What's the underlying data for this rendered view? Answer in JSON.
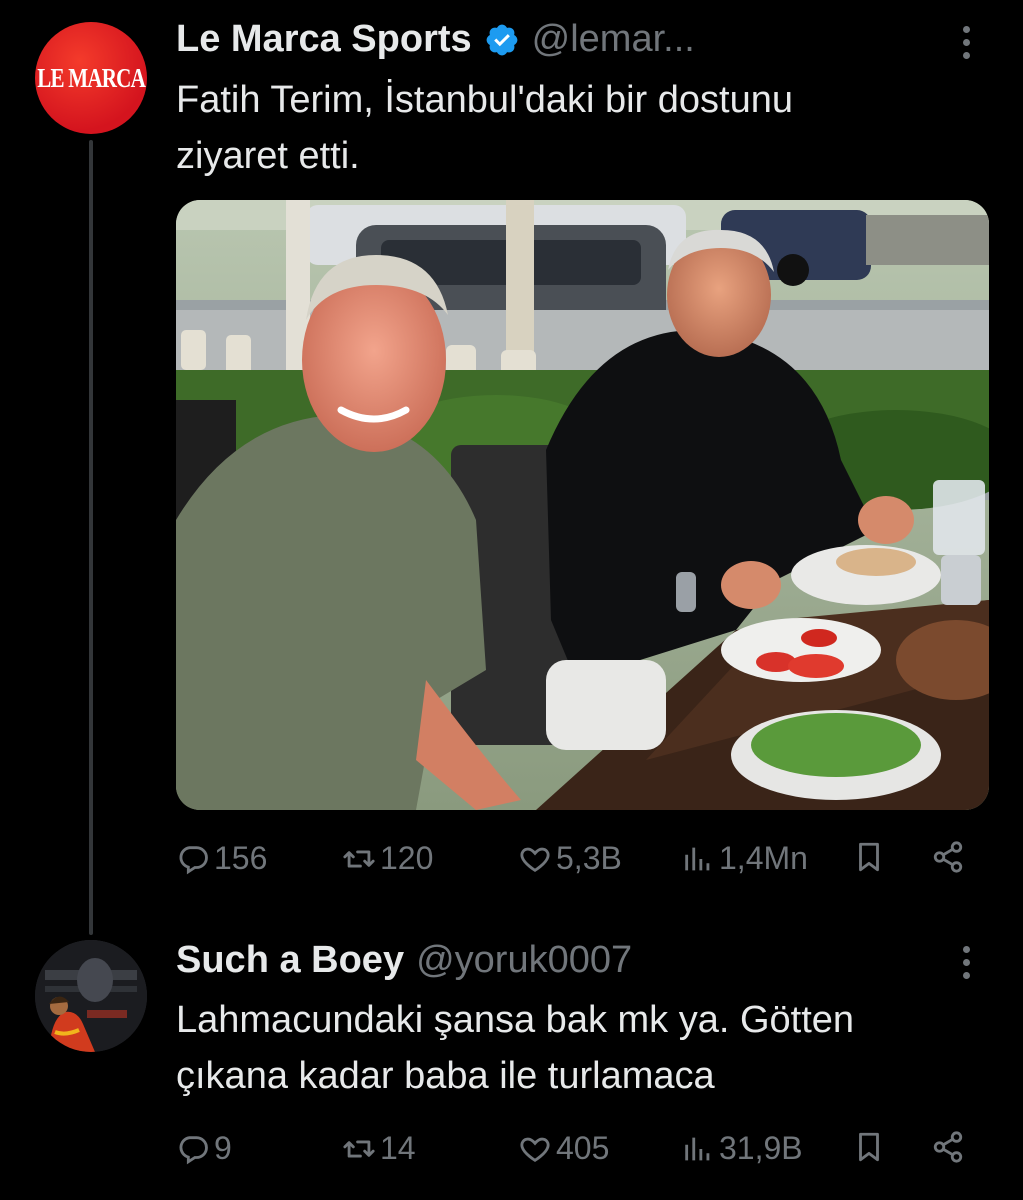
{
  "tweet": {
    "avatar_text": "LE MARCA",
    "author_name": "Le Marca Sports",
    "handle": "@lemar...",
    "text_line1": "Fatih Terim, İstanbul'daki bir dostunu",
    "text_line2": "ziyaret etti.",
    "replies": "156",
    "retweets": "120",
    "likes": "5,3B",
    "views": "1,4Mn"
  },
  "reply": {
    "author_name": "Such a Boey",
    "handle": "@yoruk0007",
    "text_line1": "Lahmacundaki şansa bak mk ya. Götten",
    "text_line2": "çıkana kadar baba ile turlamaca",
    "replies": "9",
    "retweets": "14",
    "likes": "405",
    "views": "31,9B"
  },
  "colors": {
    "background": "#000000",
    "text": "#e7e9ea",
    "muted": "#71767b",
    "verified": "#1d9bf0",
    "avatar_brand": "#e31b23"
  },
  "icons": [
    "verified-badge-icon",
    "more-icon",
    "reply-icon",
    "retweet-icon",
    "like-icon",
    "views-icon",
    "bookmark-icon",
    "share-icon"
  ]
}
